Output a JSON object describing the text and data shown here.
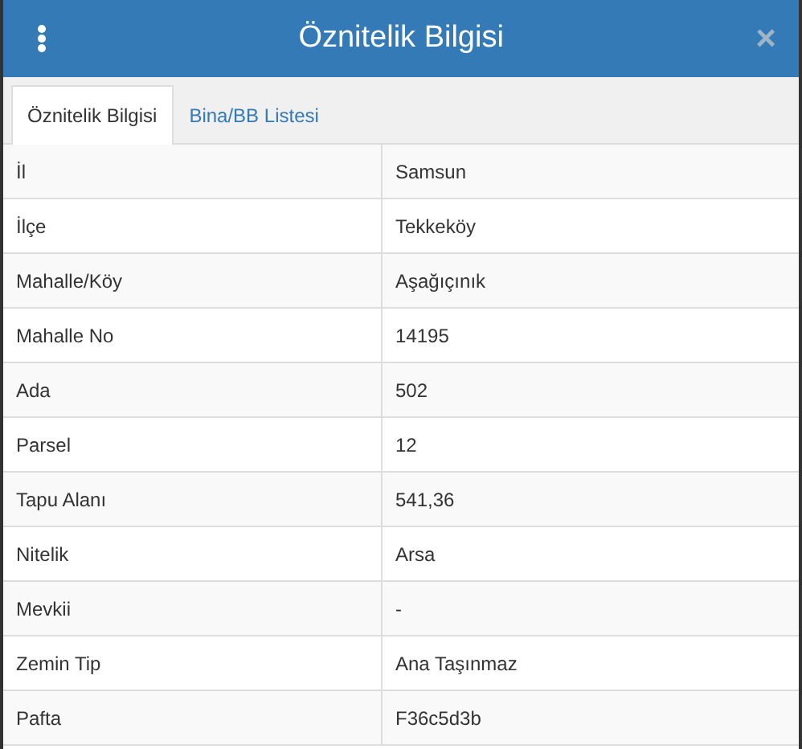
{
  "window": {
    "title": "Öznitelik Bilgisi",
    "close": "×"
  },
  "tabs": [
    {
      "label": "Öznitelik Bilgisi",
      "selected": true
    },
    {
      "label": "Bina/BB Listesi",
      "selected": false
    }
  ],
  "rows": [
    {
      "label": "İl",
      "value": "Samsun"
    },
    {
      "label": "İlçe",
      "value": "Tekkeköy"
    },
    {
      "label": "Mahalle/Köy",
      "value": "Aşağıçınık"
    },
    {
      "label": "Mahalle No",
      "value": "14195"
    },
    {
      "label": "Ada",
      "value": "502"
    },
    {
      "label": "Parsel",
      "value": "12"
    },
    {
      "label": "Tapu Alanı",
      "value": "541,36"
    },
    {
      "label": "Nitelik",
      "value": "Arsa"
    },
    {
      "label": "Mevkii",
      "value": "-"
    },
    {
      "label": "Zemin Tip",
      "value": "Ana Taşınmaz"
    },
    {
      "label": "Pafta",
      "value": "F36c5d3b"
    }
  ]
}
